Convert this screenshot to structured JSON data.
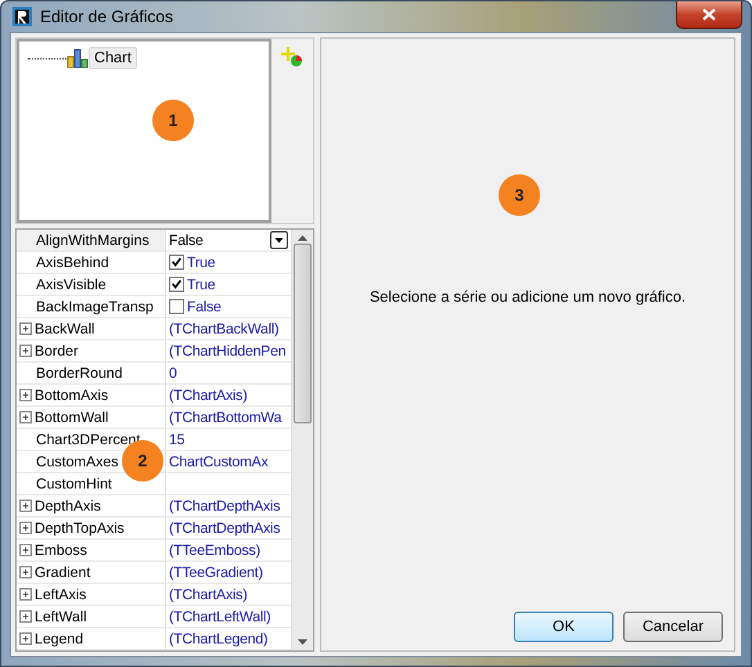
{
  "window": {
    "title": "Editor de Gráficos"
  },
  "tree": {
    "items": [
      {
        "label": "Chart",
        "selected": true
      }
    ]
  },
  "properties": [
    {
      "name": "AlignWithMargins",
      "value": "False",
      "kind": "combo",
      "selected": true
    },
    {
      "name": "AxisBehind",
      "value": "True",
      "kind": "check",
      "checked": true,
      "selected": false
    },
    {
      "name": "AxisVisible",
      "value": "True",
      "kind": "check",
      "checked": true,
      "selected": false
    },
    {
      "name": "BackImageTransp",
      "value": "False",
      "kind": "check",
      "checked": false,
      "selected": false
    },
    {
      "name": "BackWall",
      "value": "(TChartBackWall)",
      "kind": "expandable",
      "selected": false
    },
    {
      "name": "Border",
      "value": "(TChartHiddenPen",
      "kind": "expandable",
      "selected": false
    },
    {
      "name": "BorderRound",
      "value": "0",
      "kind": "plain",
      "selected": false
    },
    {
      "name": "BottomAxis",
      "value": "(TChartAxis)",
      "kind": "expandable",
      "selected": false
    },
    {
      "name": "BottomWall",
      "value": "(TChartBottomWa",
      "kind": "expandable",
      "selected": false
    },
    {
      "name": "Chart3DPercent",
      "value": "15",
      "kind": "plain",
      "selected": false
    },
    {
      "name": "CustomAxes",
      "value": "ChartCustomAx",
      "kind": "plain",
      "selected": false
    },
    {
      "name": "CustomHint",
      "kind": "plain",
      "selected": false
    },
    {
      "name": "DepthAxis",
      "value": "(TChartDepthAxis",
      "kind": "expandable",
      "selected": false
    },
    {
      "name": "DepthTopAxis",
      "value": "(TChartDepthAxis",
      "kind": "expandable",
      "selected": false
    },
    {
      "name": "Emboss",
      "value": "(TTeeEmboss)",
      "kind": "expandable",
      "selected": false
    },
    {
      "name": "Gradient",
      "value": "(TTeeGradient)",
      "kind": "expandable",
      "selected": false
    },
    {
      "name": "LeftAxis",
      "value": "(TChartAxis)",
      "kind": "expandable",
      "selected": false
    },
    {
      "name": "LeftWall",
      "value": "(TChartLeftWall)",
      "kind": "expandable",
      "selected": false
    },
    {
      "name": "Legend",
      "value": "(TChartLegend)",
      "kind": "expandable",
      "selected": false
    }
  ],
  "message": "Selecione a série ou adicione um novo gráfico.",
  "markers": [
    "1",
    "2",
    "3"
  ],
  "buttons": [
    {
      "label": "OK",
      "default": true
    },
    {
      "label": "Cancelar",
      "default": false
    }
  ]
}
